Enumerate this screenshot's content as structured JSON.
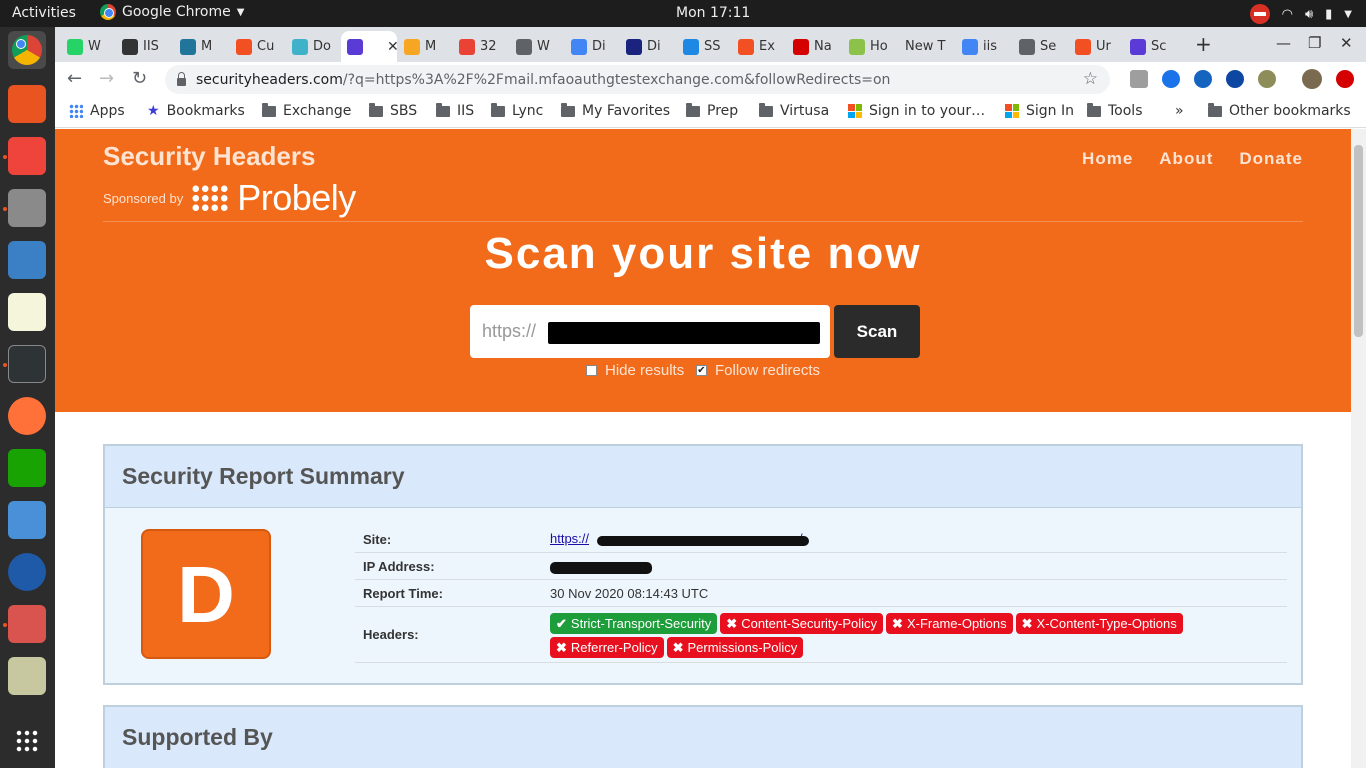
{
  "gnome": {
    "activities": "Activities",
    "app_name": "Google Chrome",
    "clock": "Mon 17:11"
  },
  "tabs": [
    {
      "label": "W",
      "color": "#25d366"
    },
    {
      "label": "IIS",
      "color": "#333333"
    },
    {
      "label": "M",
      "color": "#21759b"
    },
    {
      "label": "Cu",
      "color": "#f25022"
    },
    {
      "label": "Do",
      "color": "#3fb2c9"
    },
    {
      "label": "",
      "color": "#5b3bd6",
      "active": true
    },
    {
      "label": "M",
      "color": "#f6a623"
    },
    {
      "label": "32",
      "color": "#ea4335"
    },
    {
      "label": "W",
      "color": "#5f6368"
    },
    {
      "label": "Di",
      "color": "#4285f4"
    },
    {
      "label": "Di",
      "color": "#1a237e"
    },
    {
      "label": "SS",
      "color": "#1e88e5"
    },
    {
      "label": "Ex",
      "color": "#f25022"
    },
    {
      "label": "Na",
      "color": "#d50000"
    },
    {
      "label": "Ho",
      "color": "#8bc34a"
    },
    {
      "label": "New T",
      "color": ""
    },
    {
      "label": "iis",
      "color": "#4285f4"
    },
    {
      "label": "Se",
      "color": "#5f6368"
    },
    {
      "label": "Ur",
      "color": "#f25022"
    },
    {
      "label": "Sc",
      "color": "#5b3bd6"
    }
  ],
  "omnibox": {
    "host": "securityheaders.com",
    "path": "/?q=https%3A%2F%2Fmail.mfaoauthgtestexchange.com&followRedirects=on"
  },
  "bookmarks": [
    {
      "label": "Apps",
      "icon": "apps-grid"
    },
    {
      "label": "Bookmarks",
      "icon": "star"
    },
    {
      "label": "Exchange",
      "icon": "folder"
    },
    {
      "label": "SBS",
      "icon": "folder"
    },
    {
      "label": "IIS",
      "icon": "folder"
    },
    {
      "label": "Lync",
      "icon": "folder"
    },
    {
      "label": "My Favorites",
      "icon": "folder"
    },
    {
      "label": "Prep",
      "icon": "folder"
    },
    {
      "label": "Virtusa",
      "icon": "folder"
    },
    {
      "label": "Sign in to your…",
      "icon": "microsoft"
    },
    {
      "label": "Sign In",
      "icon": "microsoft"
    },
    {
      "label": "Tools",
      "icon": "folder"
    }
  ],
  "bookmarks_overflow": "»",
  "other_bookmarks": "Other bookmarks",
  "site": {
    "brand": "Security Headers",
    "sponsored_by": "Sponsored by",
    "sponsor_name": "Probely",
    "nav": [
      "Home",
      "About",
      "Donate"
    ],
    "headline": "Scan your site now",
    "input_value": "https://",
    "scan_button": "Scan",
    "options": [
      {
        "label": "Hide results",
        "checked": false
      },
      {
        "label": "Follow redirects",
        "checked": true
      }
    ]
  },
  "report": {
    "title": "Security Report Summary",
    "grade": "D",
    "rows": {
      "site_label": "Site:",
      "site_value": "https://",
      "ip_label": "IP Address:",
      "time_label": "Report Time:",
      "time_value": "30 Nov 2020 08:14:43 UTC",
      "headers_label": "Headers:"
    },
    "headers": [
      {
        "name": "Strict-Transport-Security",
        "status": "ok"
      },
      {
        "name": "Content-Security-Policy",
        "status": "missing"
      },
      {
        "name": "X-Frame-Options",
        "status": "missing"
      },
      {
        "name": "X-Content-Type-Options",
        "status": "missing"
      },
      {
        "name": "Referrer-Policy",
        "status": "missing"
      },
      {
        "name": "Permissions-Policy",
        "status": "missing"
      }
    ]
  },
  "supported": {
    "title": "Supported By"
  },
  "colors": {
    "brand_orange": "#f16b1a",
    "ok_green": "#1e9e3a",
    "missing_red": "#e8101e"
  }
}
